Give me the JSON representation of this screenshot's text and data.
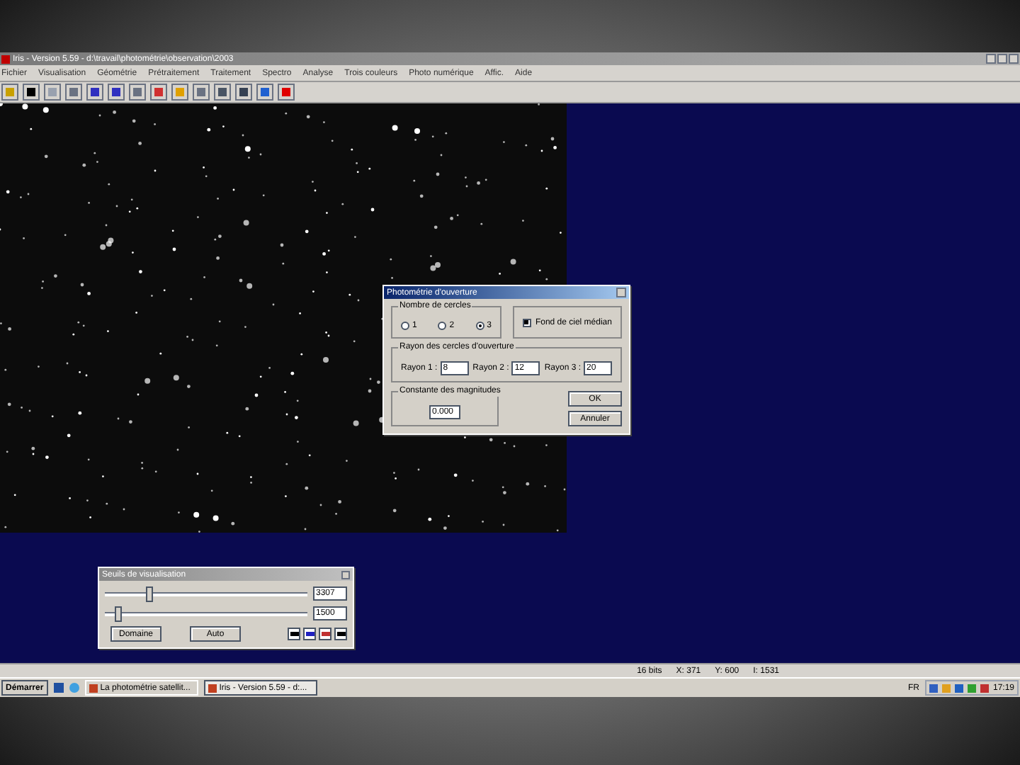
{
  "window": {
    "title": "Iris - Version 5.59 - d:\\travail\\photométrie\\observation\\2003"
  },
  "menu": [
    "Fichier",
    "Visualisation",
    "Géométrie",
    "Prétraitement",
    "Traitement",
    "Spectro",
    "Analyse",
    "Trois couleurs",
    "Photo numérique",
    "Affic.",
    "Aide"
  ],
  "dialog": {
    "title": "Photométrie d'ouverture",
    "circles_group": "Nombre de cercles",
    "radios": [
      {
        "label": "1",
        "selected": false
      },
      {
        "label": "2",
        "selected": false
      },
      {
        "label": "3",
        "selected": true
      }
    ],
    "checkbox": {
      "label": "Fond de ciel médian",
      "checked": true
    },
    "radii_group": "Rayon des cercles d'ouverture",
    "radii": [
      {
        "label": "Rayon 1 :",
        "value": "8"
      },
      {
        "label": "Rayon 2 :",
        "value": "12"
      },
      {
        "label": "Rayon 3 :",
        "value": "20"
      }
    ],
    "constant_group": "Constante des magnitudes",
    "constant_value": "0.000",
    "buttons": [
      "OK",
      "Annuler"
    ]
  },
  "thresholds": {
    "title": "Seuils de visualisation",
    "sliders": [
      {
        "level": 0.2,
        "value": "3307"
      },
      {
        "level": 0.05,
        "value": "1500"
      }
    ],
    "buttons": [
      "Domaine",
      "Auto"
    ]
  },
  "status_bar": [
    "16 bits",
    "X: 371",
    "Y: 600",
    "I: 1531"
  ],
  "taskbar": {
    "start": "Démarrer",
    "tasks": [
      {
        "label": "La photométrie satellit...",
        "selected": false
      },
      {
        "label": "Iris - Version 5.59 - d:...",
        "selected": true
      }
    ],
    "language": "FR",
    "clock": "17:19"
  }
}
